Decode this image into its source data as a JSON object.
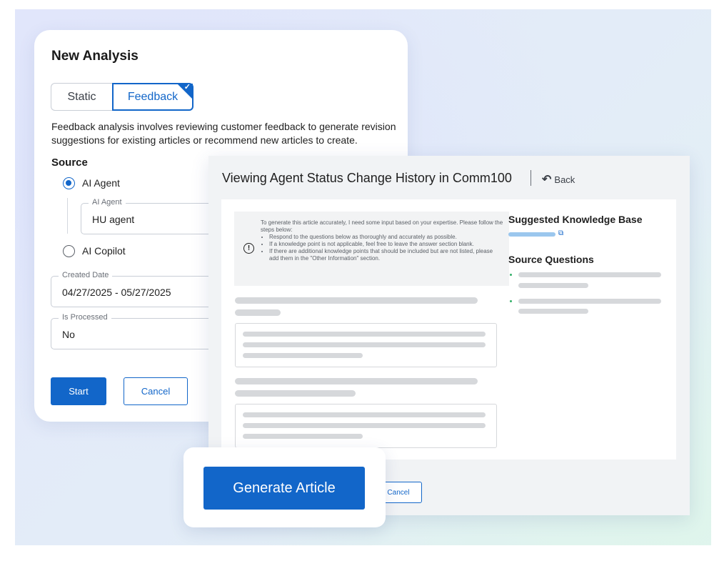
{
  "colors": {
    "accent": "#1266c9",
    "skeleton": "#d6d8db",
    "kb_bar": "#9bc7ee",
    "bullet": "#34b06a"
  },
  "analysis": {
    "title": "New Analysis",
    "tabs": {
      "static": "Static",
      "feedback": "Feedback",
      "selected": "Feedback"
    },
    "description": "Feedback analysis involves reviewing customer feedback to generate revision suggestions for existing articles or recommend new articles to create.",
    "source_label": "Source",
    "source_options": {
      "ai_agent": "AI Agent",
      "ai_copilot": "AI Copilot",
      "selected": "AI Agent"
    },
    "ai_agent_field": {
      "label": "AI Agent",
      "value": "HU agent"
    },
    "created_date_field": {
      "label": "Created Date",
      "value": "04/27/2025 - 05/27/2025"
    },
    "processed_field": {
      "label": "Is Processed",
      "value": "No"
    },
    "start_label": "Start",
    "cancel_label": "Cancel"
  },
  "article": {
    "title": "Viewing Agent Status Change History in Comm100",
    "back_label": "Back",
    "notice": {
      "intro": "To generate this article accurately, I need some input based on your expertise. Please follow the steps below:",
      "steps": [
        "Respond to the questions below as thoroughly and accurately as possible.",
        "If a knowledge point is not applicable, feel free to leave the answer section blank.",
        "If there are additional knowledge points that should be included but are not listed, please add them in the \"Other Information\" section."
      ]
    },
    "kb_title": "Suggested Knowledge Base",
    "source_questions_title": "Source Questions",
    "cancel_label": "Cancel"
  },
  "generate": {
    "label": "Generate Article"
  }
}
